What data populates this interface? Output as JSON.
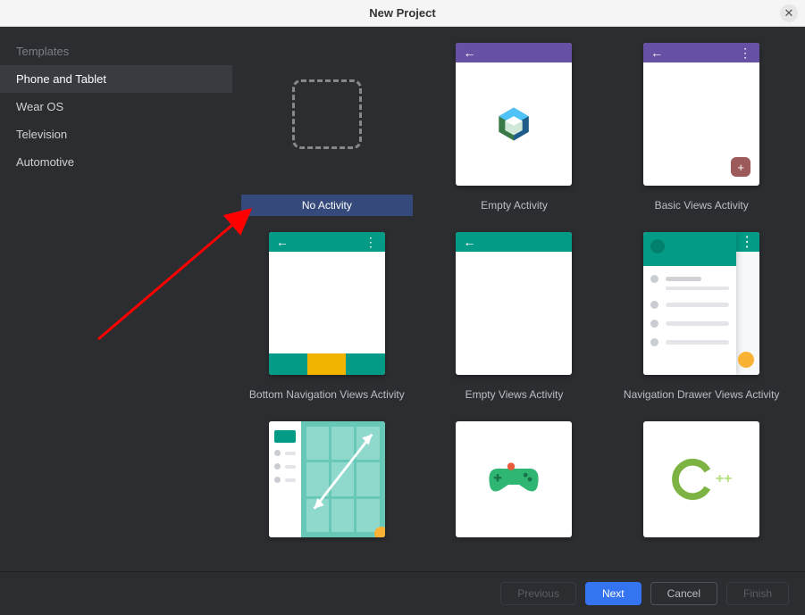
{
  "window": {
    "title": "New Project"
  },
  "sidebar": {
    "header": "Templates",
    "items": [
      {
        "label": "Phone and Tablet",
        "selected": true
      },
      {
        "label": "Wear OS",
        "selected": false
      },
      {
        "label": "Television",
        "selected": false
      },
      {
        "label": "Automotive",
        "selected": false
      }
    ]
  },
  "templates": [
    {
      "id": "no-activity",
      "label": "No Activity",
      "selected": true
    },
    {
      "id": "empty-activity",
      "label": "Empty Activity",
      "selected": false
    },
    {
      "id": "basic-views-activity",
      "label": "Basic Views Activity",
      "selected": false
    },
    {
      "id": "bottom-nav-views-activity",
      "label": "Bottom Navigation Views Activity",
      "selected": false
    },
    {
      "id": "empty-views-activity",
      "label": "Empty Views Activity",
      "selected": false
    },
    {
      "id": "nav-drawer-views-activity",
      "label": "Navigation Drawer Views Activity",
      "selected": false
    },
    {
      "id": "responsive-views-activity",
      "label": "",
      "selected": false
    },
    {
      "id": "game-activity",
      "label": "",
      "selected": false
    },
    {
      "id": "native-cpp",
      "label": "",
      "selected": false
    }
  ],
  "buttons": {
    "previous": "Previous",
    "next": "Next",
    "cancel": "Cancel",
    "finish": "Finish"
  }
}
